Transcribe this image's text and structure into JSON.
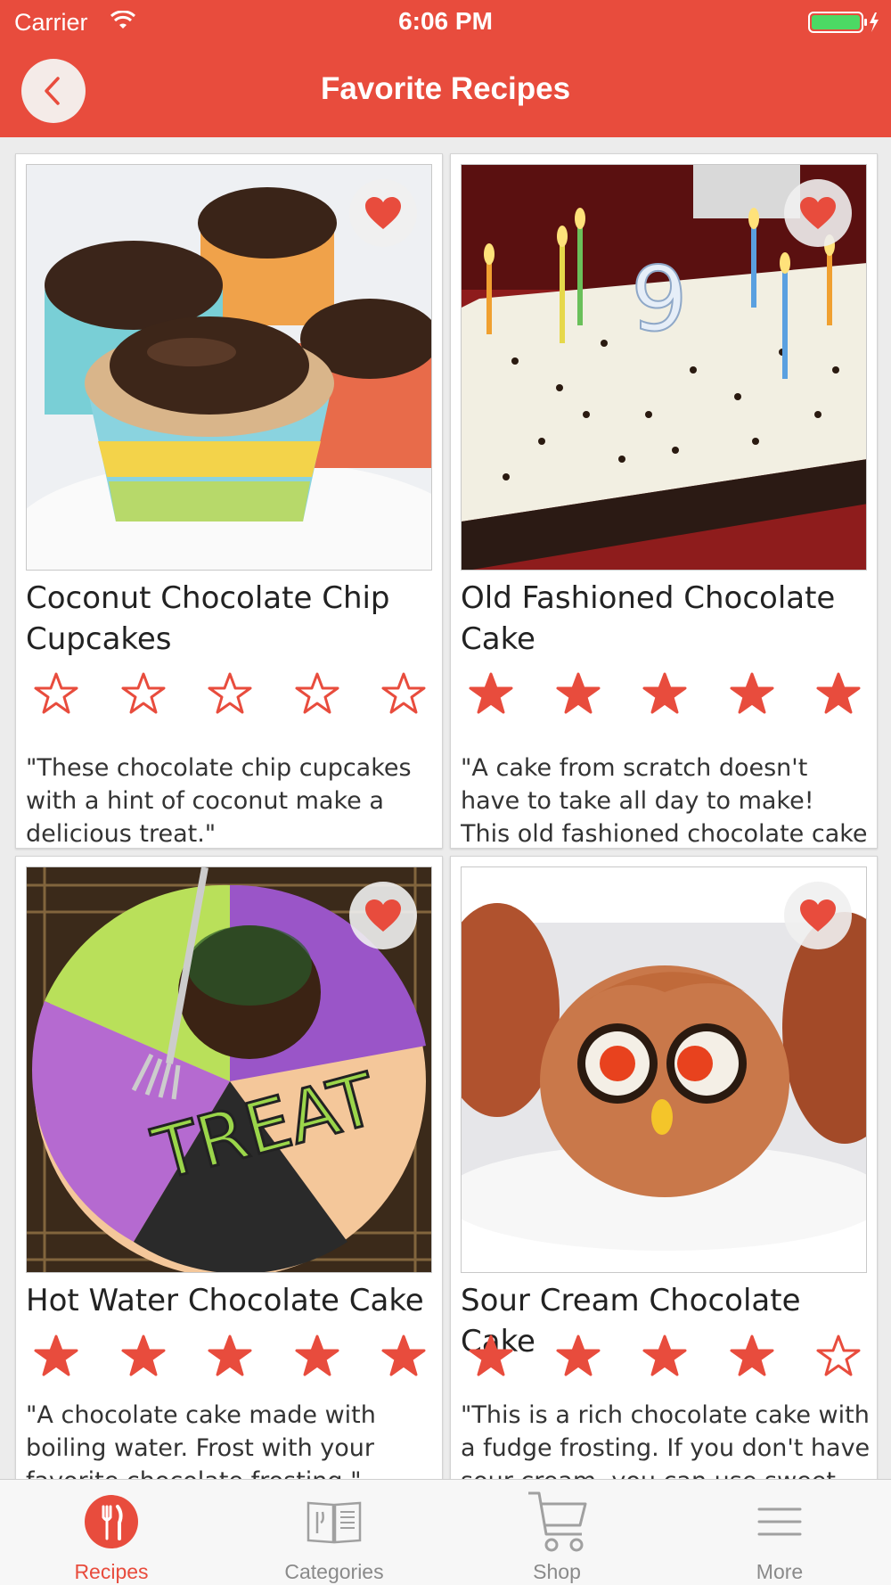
{
  "status_bar": {
    "carrier": "Carrier",
    "time": "6:06 PM",
    "wifi_icon": "wifi-icon",
    "battery_icon": "battery-charging-icon"
  },
  "header": {
    "title": "Favorite Recipes",
    "back_icon": "chevron-left-icon",
    "color": "#e84c3d"
  },
  "recipes": [
    {
      "title": "Coconut Chocolate Chip Cupcakes",
      "rating": 0,
      "description": "\"These chocolate chip cupcakes with a hint of coconut make a delicious treat.\"",
      "image": "chocolate-frosted-cupcakes-photo",
      "favorite": true
    },
    {
      "title": "Old Fashioned Chocolate Cake",
      "rating": 5,
      "description": "\"A cake from scratch doesn't have to take all day to make!  This old fashioned chocolate cake is mad…",
      "image": "birthday-sheet-cake-with-candles-photo",
      "favorite": true
    },
    {
      "title": "Hot Water Chocolate Cake",
      "rating": 5,
      "description": "\"A chocolate cake made with boiling water. Frost with your favorite chocolate frosting.\"",
      "image": "halloween-trick-or-treat-plate-cake-photo",
      "favorite": true
    },
    {
      "title": "Sour Cream Chocolate Cake",
      "rating": 4,
      "description": "\"This is a rich chocolate cake with a fudge frosting.  If you don't have sour cream, you can use sweet c…",
      "image": "owl-cupcake-photo",
      "favorite": true
    }
  ],
  "tab_bar": {
    "tabs": [
      {
        "label": "Recipes",
        "icon": "fork-knife-icon",
        "active": true
      },
      {
        "label": "Categories",
        "icon": "recipe-book-icon",
        "active": false
      },
      {
        "label": "Shop",
        "icon": "shopping-cart-icon",
        "active": false
      },
      {
        "label": "More",
        "icon": "hamburger-menu-icon",
        "active": false
      }
    ]
  },
  "colors": {
    "accent": "#e84c3d",
    "star": "#e84c3d",
    "tab_inactive": "#8a8a8a"
  }
}
